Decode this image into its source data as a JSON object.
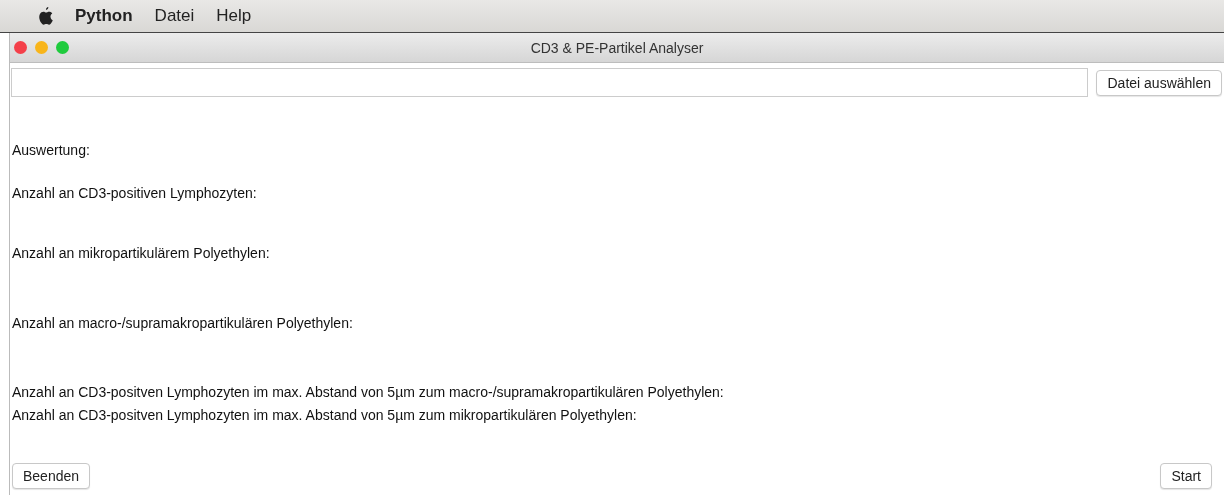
{
  "menu_bar": {
    "items": [
      {
        "label": "Python",
        "bold": true
      },
      {
        "label": "Datei",
        "bold": false
      },
      {
        "label": "Help",
        "bold": false
      }
    ]
  },
  "window": {
    "title": "CD3 & PE-Partikel Analyser"
  },
  "choose_button": "Datei auswählen",
  "result_lines": [
    "Auswertung:",
    "Anzahl an CD3-positiven Lymphozyten:",
    "Anzahl an mikropartikulärem Polyethylen:",
    "Anzahl an macro-/supramakropartikulären Polyethylen:",
    "Anzahl an CD3-positven Lymphozyten im max. Abstand von 5µm zum macro-/supramakropartikulären Polyethylen:",
    "Anzahl an CD3-positven Lymphozyten im max. Abstand von 5µm zum mikropartikulären Polyethylen:"
  ],
  "buttons": [
    "Beenden",
    "Start"
  ]
}
